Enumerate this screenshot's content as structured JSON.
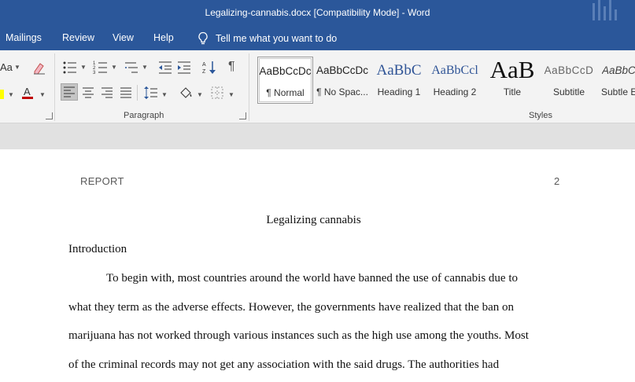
{
  "window": {
    "title": "Legalizing-cannabis.docx [Compatibility Mode]  -  Word"
  },
  "tabs": [
    {
      "label": "Mailings"
    },
    {
      "label": "Review"
    },
    {
      "label": "View"
    },
    {
      "label": "Help"
    }
  ],
  "tell_me": {
    "label": "Tell me what you want to do"
  },
  "ribbon": {
    "font_group": {
      "partial_label": "Aa"
    },
    "paragraph_group": {
      "label": "Paragraph",
      "pilcrow": "¶"
    },
    "styles_group": {
      "label": "Styles",
      "items": [
        {
          "sample": "AaBbCcDc",
          "name": "¶ Normal"
        },
        {
          "sample": "AaBbCcDc",
          "name": "¶ No Spac..."
        },
        {
          "sample": "AaBbC",
          "name": "Heading 1"
        },
        {
          "sample": "AaBbCcl",
          "name": "Heading 2"
        },
        {
          "sample": "AaB",
          "name": "Title"
        },
        {
          "sample": "AaBbCcD",
          "name": "Subtitle"
        },
        {
          "sample": "AaBbC",
          "name": "Subtle E"
        }
      ]
    },
    "colors": {
      "font_color": "#c00000",
      "highlight": "#ffff00",
      "accent": "#2b579a"
    }
  },
  "document": {
    "header_left": "REPORT",
    "header_page_number": "2",
    "title": "Legalizing cannabis",
    "heading": "Introduction",
    "lines": [
      "To begin with, most countries around the world have banned the use of cannabis due to",
      "what they term as the adverse effects. However, the governments have realized that the ban on",
      "marijuana has not worked through various instances such as the high use among the youths. Most",
      "of the criminal records may not get any association with the said drugs. The authorities had"
    ]
  }
}
